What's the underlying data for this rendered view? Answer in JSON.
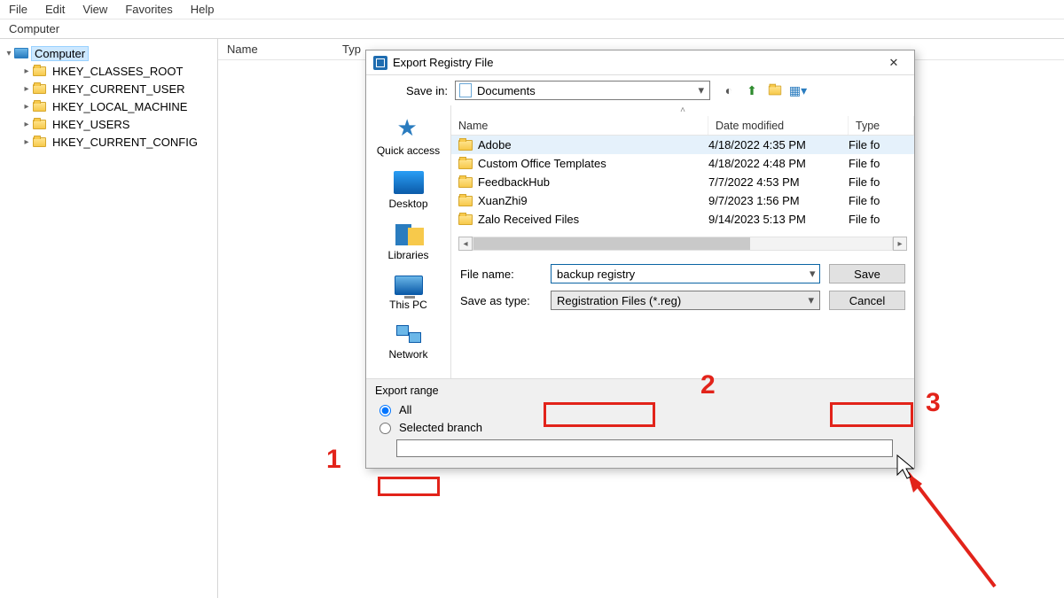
{
  "menu": {
    "file": "File",
    "edit": "Edit",
    "view": "View",
    "favorites": "Favorites",
    "help": "Help"
  },
  "address": "Computer",
  "tree": {
    "root": "Computer",
    "keys": [
      "HKEY_CLASSES_ROOT",
      "HKEY_CURRENT_USER",
      "HKEY_LOCAL_MACHINE",
      "HKEY_USERS",
      "HKEY_CURRENT_CONFIG"
    ]
  },
  "list_header": {
    "name": "Name",
    "type": "Typ"
  },
  "dialog": {
    "title": "Export Registry File",
    "save_in_label": "Save in:",
    "save_in_value": "Documents",
    "places": {
      "quick": "Quick access",
      "desktop": "Desktop",
      "libraries": "Libraries",
      "thispc": "This PC",
      "network": "Network"
    },
    "columns": {
      "name": "Name",
      "date": "Date modified",
      "type": "Type"
    },
    "rows": [
      {
        "name": "Adobe",
        "date": "4/18/2022 4:35 PM",
        "type": "File fo"
      },
      {
        "name": "Custom Office Templates",
        "date": "4/18/2022 4:48 PM",
        "type": "File fo"
      },
      {
        "name": "FeedbackHub",
        "date": "7/7/2022 4:53 PM",
        "type": "File fo"
      },
      {
        "name": "XuanZhi9",
        "date": "9/7/2023 1:56 PM",
        "type": "File fo"
      },
      {
        "name": "Zalo Received Files",
        "date": "9/14/2023 5:13 PM",
        "type": "File fo"
      }
    ],
    "file_name_label": "File name:",
    "file_name_value": "backup registry",
    "save_as_type_label": "Save as type:",
    "save_as_type_value": "Registration Files (*.reg)",
    "save_btn": "Save",
    "cancel_btn": "Cancel",
    "export_range_label": "Export range",
    "opt_all": "All",
    "opt_selected": "Selected branch"
  },
  "annotations": {
    "n1": "1",
    "n2": "2",
    "n3": "3"
  }
}
